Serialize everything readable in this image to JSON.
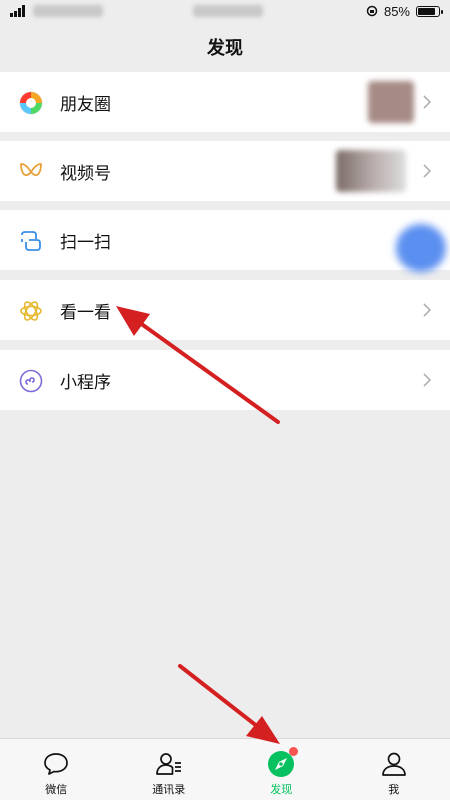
{
  "status": {
    "battery": "85%",
    "battery_level": 0.85
  },
  "header": {
    "title": "发现"
  },
  "menu": {
    "moments": "朋友圈",
    "channels": "视频号",
    "scan": "扫一扫",
    "top_stories": "看一看",
    "mini_programs": "小程序"
  },
  "tabbar": {
    "chats": "微信",
    "contacts": "通讯录",
    "discover": "发现",
    "me": "我",
    "active_color": "#07c160"
  },
  "annotations": {
    "arrow_color": "#d42020"
  }
}
